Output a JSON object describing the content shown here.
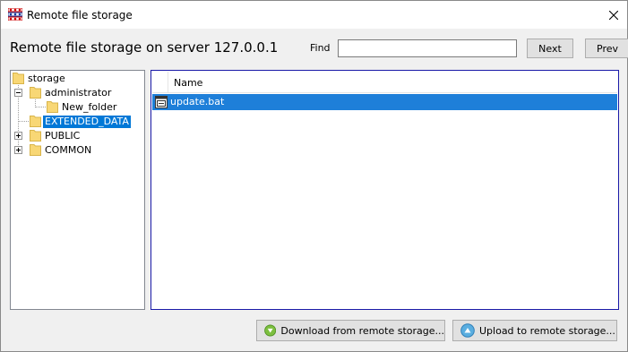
{
  "window": {
    "title": "Remote file storage"
  },
  "header": {
    "title": "Remote file storage on server 127.0.0.1"
  },
  "search": {
    "label": "Find",
    "value": "",
    "placeholder": "",
    "next_label": "Next",
    "prev_label": "Prev"
  },
  "tree": {
    "items": [
      {
        "label": "storage",
        "expander": "none",
        "selected": false
      },
      {
        "label": "administrator",
        "expander": "expanded",
        "selected": false
      },
      {
        "label": "New_folder",
        "expander": "none",
        "selected": false
      },
      {
        "label": "EXTENDED_DATA",
        "expander": "none",
        "selected": true
      },
      {
        "label": "PUBLIC",
        "expander": "collapsed",
        "selected": false
      },
      {
        "label": "COMMON",
        "expander": "collapsed",
        "selected": false
      }
    ]
  },
  "files": {
    "columns": [
      "Name"
    ],
    "rows": [
      {
        "name": "update.bat",
        "icon": "batch-file-icon",
        "selected": true
      }
    ]
  },
  "actions": {
    "download_label": "Download from remote storage...",
    "upload_label": "Upload to remote storage..."
  },
  "colors": {
    "selection": "#0078d7",
    "row_selection": "#1e7fd9",
    "folder": "#f8d775",
    "panel_border_active": "#1a1aa8"
  }
}
